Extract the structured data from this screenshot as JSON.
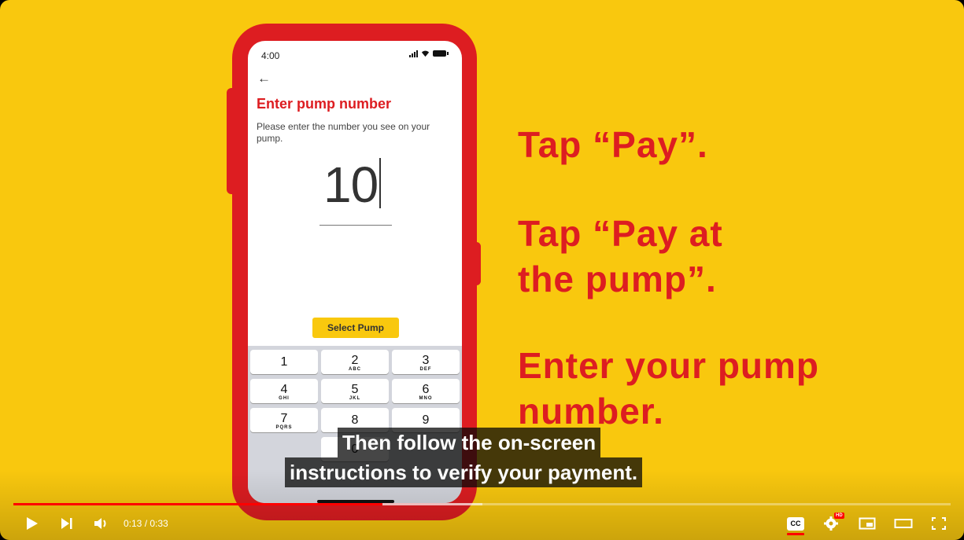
{
  "phone": {
    "status_time": "4:00",
    "back_icon": "back-arrow-icon",
    "title": "Enter pump number",
    "description": "Please enter the number you see on your pump.",
    "pump_value": "10",
    "button_label": "Select Pump",
    "keypad": [
      {
        "digit": "1",
        "letters": ""
      },
      {
        "digit": "2",
        "letters": "ABC"
      },
      {
        "digit": "3",
        "letters": "DEF"
      },
      {
        "digit": "4",
        "letters": "GHI"
      },
      {
        "digit": "5",
        "letters": "JKL"
      },
      {
        "digit": "6",
        "letters": "MNO"
      },
      {
        "digit": "7",
        "letters": "PQRS"
      },
      {
        "digit": "8",
        "letters": ""
      },
      {
        "digit": "9",
        "letters": ""
      },
      {
        "digit": "0",
        "letters": ""
      }
    ]
  },
  "instructions": {
    "line1": "Tap “Pay”.",
    "line2a": "Tap “Pay at",
    "line2b": "the pump”.",
    "line3a": "Enter your pump",
    "line3b": "number."
  },
  "captions": {
    "line1": "Then follow the on-screen",
    "line2": "instructions to verify your payment."
  },
  "player": {
    "current_time": "0:13",
    "duration": "0:33",
    "time_separator": " / ",
    "played_fraction": 0.394,
    "loaded_fraction": 0.5,
    "hd_badge": "HD",
    "cc_label": "CC",
    "colors": {
      "brand_yellow": "#f9c80e",
      "brand_red": "#dd1d21",
      "progress_red": "#ff0000"
    }
  }
}
